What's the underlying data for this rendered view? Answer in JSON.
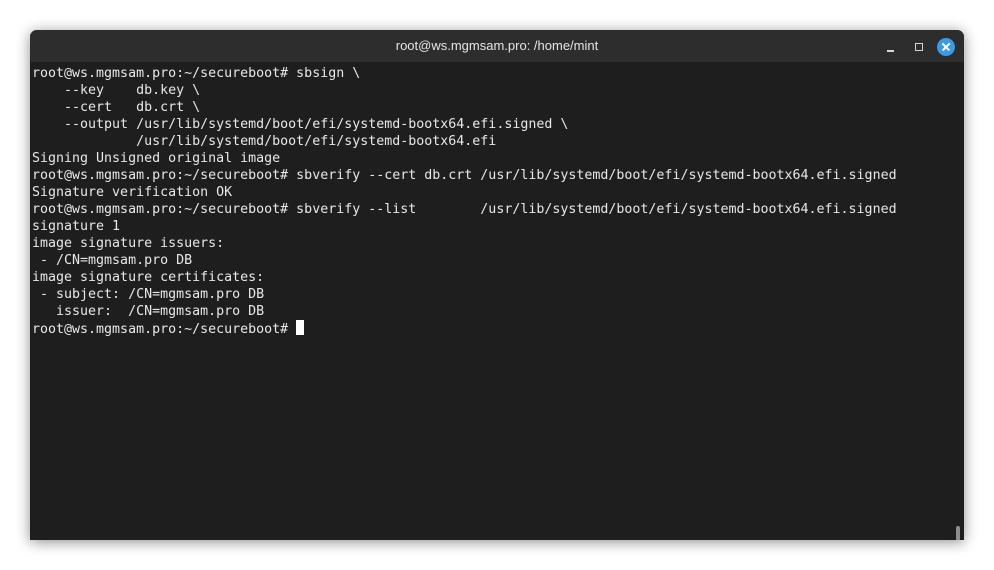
{
  "window": {
    "title": "root@ws.mgmsam.pro: /home/mint"
  },
  "terminal": {
    "lines": [
      "root@ws.mgmsam.pro:~/secureboot# sbsign \\",
      "    --key    db.key \\",
      "    --cert   db.crt \\",
      "    --output /usr/lib/systemd/boot/efi/systemd-bootx64.efi.signed \\",
      "             /usr/lib/systemd/boot/efi/systemd-bootx64.efi",
      "Signing Unsigned original image",
      "root@ws.mgmsam.pro:~/secureboot# sbverify --cert db.crt /usr/lib/systemd/boot/efi/systemd-bootx64.efi.signed",
      "Signature verification OK",
      "root@ws.mgmsam.pro:~/secureboot# sbverify --list        /usr/lib/systemd/boot/efi/systemd-bootx64.efi.signed",
      "signature 1",
      "image signature issuers:",
      " - /CN=mgmsam.pro DB",
      "image signature certificates:",
      " - subject: /CN=mgmsam.pro DB",
      "   issuer:  /CN=mgmsam.pro DB",
      "root@ws.mgmsam.pro:~/secureboot# "
    ]
  },
  "icons": {
    "minimize": "minimize-icon",
    "maximize": "maximize-icon",
    "close": "close-icon"
  },
  "colors": {
    "terminal_bg": "#1e1e1e",
    "titlebar_bg": "#2d2d2d",
    "text": "#e8e8e8",
    "close_button": "#3a9ae6"
  }
}
